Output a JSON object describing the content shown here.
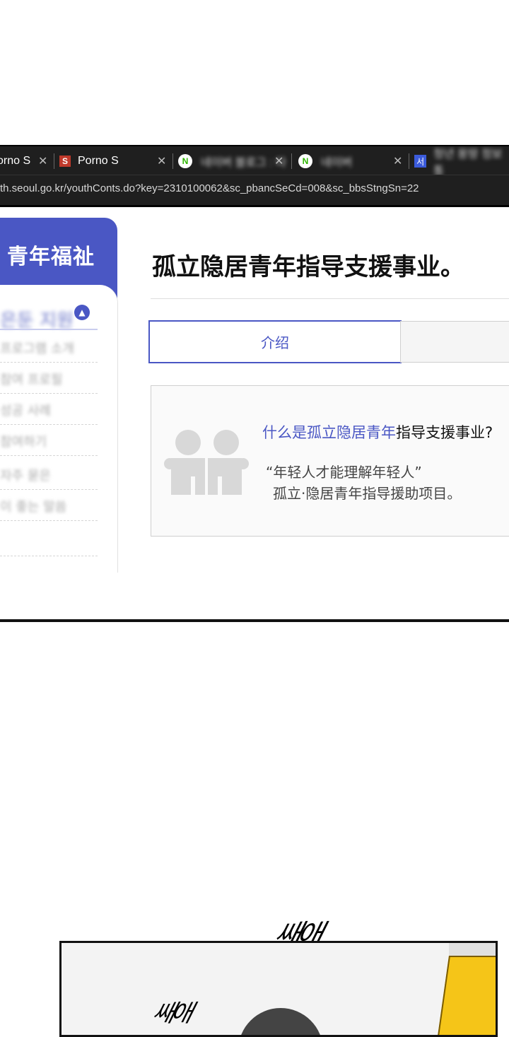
{
  "browser": {
    "tabs": [
      {
        "title": "orno S",
        "icon": "close-icon"
      },
      {
        "favicon": "S",
        "title": "Porno S",
        "icon": "close-icon"
      },
      {
        "favicon": "N",
        "title": "네이버 블로그 : 다",
        "icon": "close-icon"
      },
      {
        "favicon": "N",
        "title": "네이버",
        "icon": "close-icon"
      },
      {
        "favicon": "서",
        "title": "청년 몽땅 정보통"
      }
    ],
    "url": "th.seoul.go.kr/youthConts.do?key=2310100062&sc_pbancSeCd=008&sc_bbsStngSn=22"
  },
  "sidebar": {
    "title": "青年福祉",
    "category": "은둔 지원",
    "items": [
      "프로그램 소개",
      "참여 프로필",
      "성공 사례",
      "참여하기",
      "자주 묻은",
      "이 좋는 말씀"
    ]
  },
  "page": {
    "title": "孤立隐居青年指导支援事业。",
    "tabs": {
      "active": "介绍"
    },
    "info": {
      "question_highlight": "什么是孤立隐居青年",
      "question_rest": "指导支援事业?",
      "quote": "“年轻人才能理解年轻人”",
      "desc": "孤立·隐居青年指导援助项目。"
    }
  },
  "comic": {
    "sfx_top": "쌔애",
    "sfx_bottom": "쌔애"
  },
  "colors": {
    "accent": "#4a57c4",
    "chrome": "#1f1f1f"
  }
}
